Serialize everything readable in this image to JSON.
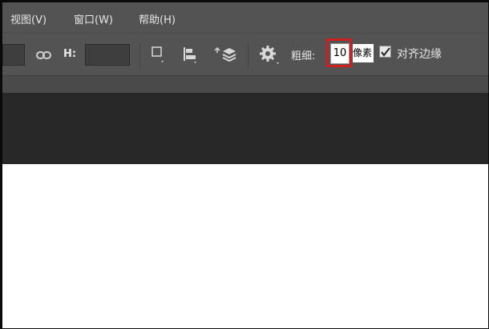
{
  "menu": {
    "items": [
      {
        "label": "视图(V)"
      },
      {
        "label": "窗口(W)"
      },
      {
        "label": "帮助(H)"
      }
    ]
  },
  "options_bar": {
    "height_label": "H:",
    "stroke_label": "粗细:",
    "stroke_value": "10",
    "stroke_unit": "像素",
    "align_edges_label": "对齐边缘",
    "align_edges_checked": true
  },
  "colors": {
    "chrome": "#535353",
    "workspace": "#282828",
    "highlight": "#cc1f1f"
  }
}
